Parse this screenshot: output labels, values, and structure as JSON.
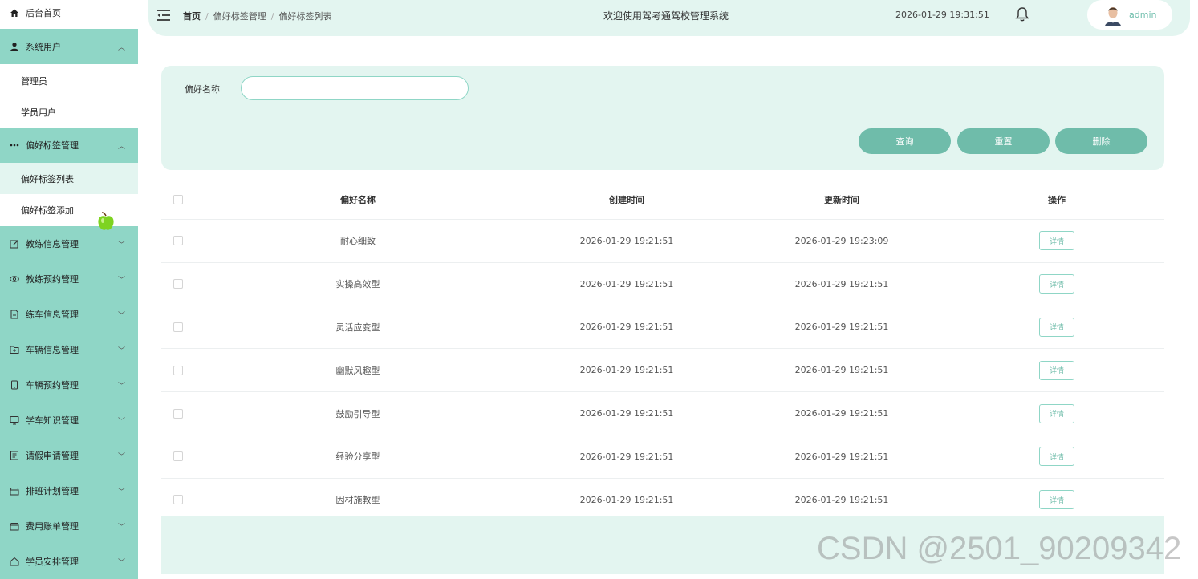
{
  "sidebar": {
    "home": "后台首页",
    "groups": [
      {
        "label": "系统用户",
        "icon": "user-icon",
        "expanded": true,
        "children": [
          "管理员",
          "学员用户"
        ]
      },
      {
        "label": "偏好标签管理",
        "icon": "more-dots-icon",
        "expanded": true,
        "children": [
          "偏好标签列表",
          "偏好标签添加"
        ],
        "active_child": 0
      },
      {
        "label": "教练信息管理",
        "icon": "edit-icon"
      },
      {
        "label": "教练预约管理",
        "icon": "eye-icon"
      },
      {
        "label": "练车信息管理",
        "icon": "document-icon"
      },
      {
        "label": "车辆信息管理",
        "icon": "folder-add-icon"
      },
      {
        "label": "车辆预约管理",
        "icon": "phone-icon"
      },
      {
        "label": "学车知识管理",
        "icon": "monitor-icon"
      },
      {
        "label": "请假申请管理",
        "icon": "notebook-icon"
      },
      {
        "label": "排班计划管理",
        "icon": "box-icon"
      },
      {
        "label": "费用账单管理",
        "icon": "box-icon"
      },
      {
        "label": "学员安排管理",
        "icon": "house-icon"
      }
    ]
  },
  "header": {
    "breadcrumb": [
      "首页",
      "偏好标签管理",
      "偏好标签列表"
    ],
    "title": "欢迎使用驾考通驾校管理系统",
    "datetime": "2026-01-29 19:31:51",
    "username": "admin"
  },
  "search": {
    "label": "偏好名称",
    "value": "",
    "placeholder": "",
    "buttons": {
      "query": "查询",
      "reset": "重置",
      "delete": "删除"
    }
  },
  "table": {
    "columns": [
      "偏好名称",
      "创建时间",
      "更新时间",
      "操作"
    ],
    "detail_label": "详情",
    "rows": [
      {
        "name": "耐心细致",
        "created": "2026-01-29 19:21:51",
        "updated": "2026-01-29 19:23:09"
      },
      {
        "name": "实操高效型",
        "created": "2026-01-29 19:21:51",
        "updated": "2026-01-29 19:21:51"
      },
      {
        "name": "灵活应变型",
        "created": "2026-01-29 19:21:51",
        "updated": "2026-01-29 19:21:51"
      },
      {
        "name": "幽默风趣型",
        "created": "2026-01-29 19:21:51",
        "updated": "2026-01-29 19:21:51"
      },
      {
        "name": "鼓励引导型",
        "created": "2026-01-29 19:21:51",
        "updated": "2026-01-29 19:21:51"
      },
      {
        "name": "经验分享型",
        "created": "2026-01-29 19:21:51",
        "updated": "2026-01-29 19:21:51"
      },
      {
        "name": "因材施教型",
        "created": "2026-01-29 19:21:51",
        "updated": "2026-01-29 19:21:51"
      }
    ]
  },
  "watermark": "CSDN @2501_90209342",
  "colors": {
    "accent": "#8fd6c6",
    "panel": "#e3f5f0",
    "button": "#6fbcaa"
  }
}
